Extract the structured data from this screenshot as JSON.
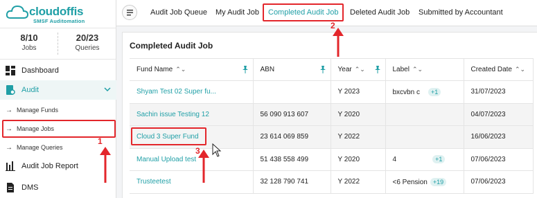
{
  "brand": {
    "name": "cloudoffis",
    "subtitle": "SMSF Auditomation"
  },
  "stats": [
    {
      "value": "8/10",
      "label": "Jobs"
    },
    {
      "value": "20/23",
      "label": "Queries"
    }
  ],
  "sidebar": {
    "items": [
      {
        "label": "Dashboard",
        "icon": "dashboard-icon"
      },
      {
        "label": "Audit",
        "icon": "audit-icon"
      },
      {
        "label": "Audit Job Report",
        "icon": "report-icon"
      },
      {
        "label": "DMS",
        "icon": "document-icon"
      }
    ],
    "sub_items": [
      {
        "label": "Manage Funds"
      },
      {
        "label": "Manage Jobs"
      },
      {
        "label": "Manage Queries"
      }
    ]
  },
  "tabs": [
    {
      "label": "Audit Job Queue"
    },
    {
      "label": "My Audit Job"
    },
    {
      "label": "Completed Audit Job"
    },
    {
      "label": "Deleted Audit Job"
    },
    {
      "label": "Submitted by Accountant"
    }
  ],
  "card": {
    "title": "Completed Audit Job"
  },
  "table": {
    "columns": [
      "Fund Name",
      "ABN",
      "Year",
      "Label",
      "Created Date"
    ],
    "rows": [
      {
        "fund": "Shyam Test 02 Super fu...",
        "abn": "",
        "year": "Y 2023",
        "label": "bxcvbn c",
        "badge": "+1",
        "date": "31/07/2023"
      },
      {
        "fund": "Sachin issue Testing 12",
        "abn": "56 090 913 607",
        "year": "Y 2020",
        "label": "",
        "badge": "",
        "date": "04/07/2023"
      },
      {
        "fund": "Cloud 3 Super Fund",
        "abn": "23 614 069 859",
        "year": "Y 2022",
        "label": "",
        "badge": "",
        "date": "16/06/2023"
      },
      {
        "fund": "Manual Upload test",
        "abn": "51 438 558 499",
        "year": "Y 2020",
        "label": "4",
        "badge": "+1",
        "date": "07/06/2023"
      },
      {
        "fund": "Trusteetest",
        "abn": "32 128 790 741",
        "year": "Y 2022",
        "label": "<6 Pension",
        "badge": "+19",
        "date": "07/06/2023"
      }
    ]
  },
  "annotations": {
    "step1": "1",
    "step2": "2",
    "step3": "3"
  },
  "colors": {
    "accent": "#1f9fa6",
    "highlight": "#e3262b"
  }
}
